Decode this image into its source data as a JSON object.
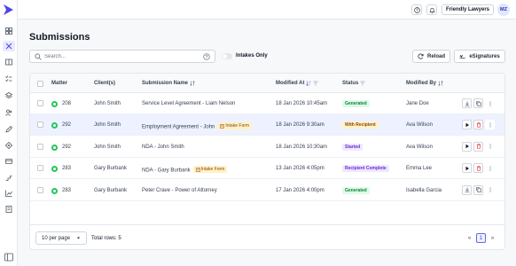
{
  "topbar": {
    "org_label": "Friendly Lawyers",
    "avatar_initials": "MZ"
  },
  "page": {
    "title": "Submissions"
  },
  "toolbar": {
    "search_placeholder": "Search...",
    "toggle_label": "Intakes Only",
    "toggle_on": false,
    "reload_label": "Reload",
    "esign_label": "eSignatures"
  },
  "table": {
    "headers": {
      "matter": "Matter",
      "clients": "Client(s)",
      "submission_name": "Submission Name",
      "modified_at": "Modified At",
      "status": "Status",
      "modified_by": "Modified By"
    },
    "rows": [
      {
        "matter": "208",
        "client": "John Smith",
        "name": "Service Level Agreement - Liam Nelson",
        "intake": "",
        "modified_at": "18 Jan 2026 10:45am",
        "status": "Generated",
        "modified_by": "Jane Doe"
      },
      {
        "matter": "292",
        "client": "John Smith",
        "name": "Employment Agreement - John",
        "intake": "Intake Form",
        "modified_at": "18 Jan 2026 9:30am",
        "status": "With Recipient",
        "modified_by": "Ava Wilson"
      },
      {
        "matter": "292",
        "client": "John Smith",
        "name": "NDA - John Smith",
        "intake": "",
        "modified_at": "18 Jan 2026 10:30am",
        "status": "Started",
        "modified_by": "Ava Wilson"
      },
      {
        "matter": "283",
        "client": "Gary Burbank",
        "name": "NDA - Gary Burbank",
        "intake": "Intake Form",
        "modified_at": "13 Jan 2026 4:05pm",
        "status": "Recipient Complete",
        "modified_by": "Emma Lee"
      },
      {
        "matter": "283",
        "client": "Gary Burbank",
        "name": "Peter Crave - Power of Attorney",
        "intake": "",
        "modified_at": "17 Jan 2026 4:00pm",
        "status": "Generated",
        "modified_by": "Isabella Garcia"
      }
    ]
  },
  "footer": {
    "per_page": "10 per page",
    "total_rows": "Total rows: 5",
    "prev": "«",
    "current_page": "1",
    "next": "»"
  },
  "colors": {
    "accent": "#4f46e5",
    "generated_bg": "#dcfce7",
    "generated_fg": "#15803d",
    "with_recipient_bg": "#fef3c7",
    "with_recipient_fg": "#92400e",
    "started_bg": "#ede9fe",
    "started_fg": "#6d28d9",
    "recipient_complete_bg": "#ede9fe",
    "recipient_complete_fg": "#6d28d9",
    "highlight_row": "#eef1ff"
  }
}
